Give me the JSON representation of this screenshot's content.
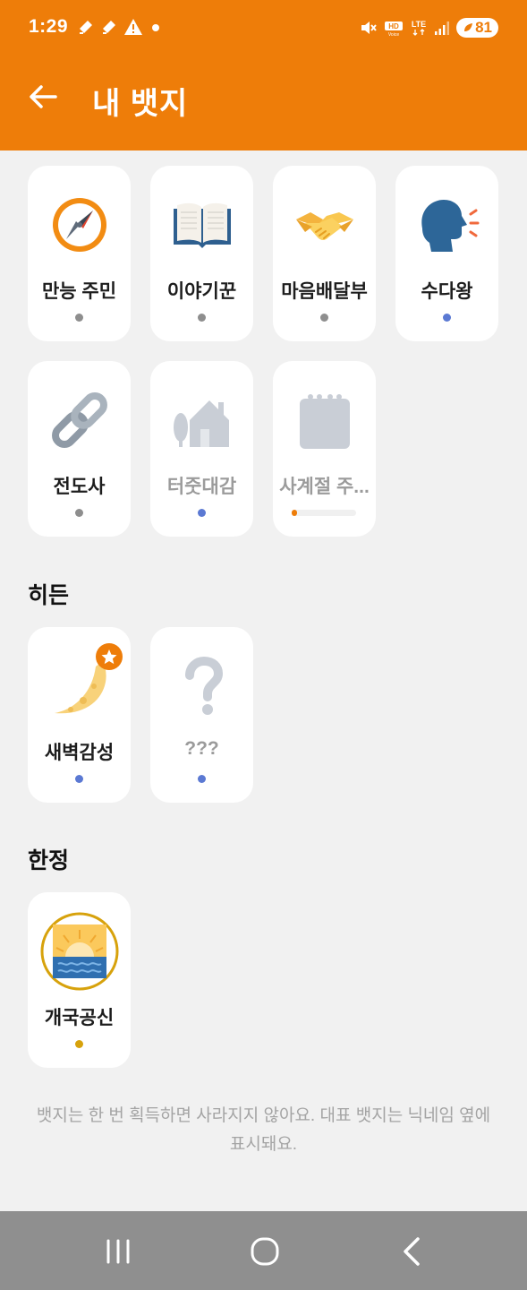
{
  "status_bar": {
    "time": "1:29",
    "battery": "81",
    "lte": "LTE",
    "hd": "HD"
  },
  "header": {
    "title": "내 뱃지",
    "back_icon": "arrow-left-icon"
  },
  "badges": [
    {
      "label": "만능 주민",
      "icon": "compass-icon",
      "dot": "gray"
    },
    {
      "label": "이야기꾼",
      "icon": "open-book-icon",
      "dot": "gray"
    },
    {
      "label": "마음배달부",
      "icon": "handshake-icon",
      "dot": "gray"
    },
    {
      "label": "수다왕",
      "icon": "speaking-head-icon",
      "dot": "blue"
    },
    {
      "label": "전도사",
      "icon": "link-icon",
      "dot": "gray"
    },
    {
      "label": "터줏대감",
      "icon": "house-icon",
      "dot": "blue",
      "locked": true
    },
    {
      "label": "사계절 주...",
      "icon": "calendar-icon",
      "locked": true,
      "progress": 0.08
    }
  ],
  "hidden_section": {
    "title": "히든",
    "badges": [
      {
        "label": "새벽감성",
        "icon": "crescent-moon-icon",
        "dot": "blue",
        "starred": true
      },
      {
        "label": "???",
        "icon": "question-mark-icon",
        "dot": "blue",
        "locked": true
      }
    ]
  },
  "limited_section": {
    "title": "한정",
    "badges": [
      {
        "label": "개국공신",
        "icon": "sunrise-icon",
        "dot": "gold"
      }
    ]
  },
  "footnote": "뱃지는 한 번 획득하면 사라지지 않아요. 대표 뱃지는 닉네임 옆에 표시돼요.",
  "colors": {
    "accent": "#ee7d09",
    "background": "#f1f1f1",
    "dot_gray": "#8e8e8e",
    "dot_blue": "#5b79d3",
    "dot_gold": "#d7a20c"
  }
}
